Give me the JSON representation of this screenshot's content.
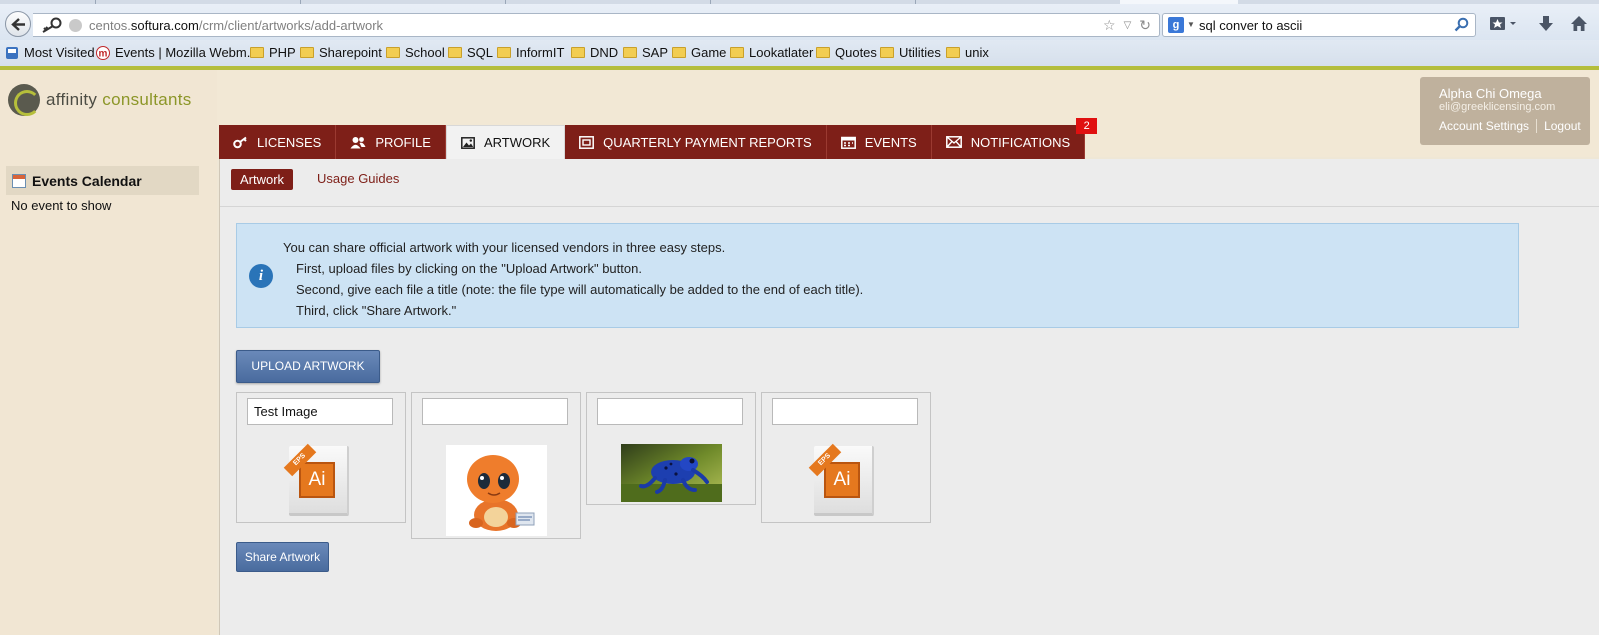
{
  "browser": {
    "url_prefix": "centos.",
    "url_domain": "softura.com",
    "url_path": "/crm/client/artworks/add-artwork",
    "search_query": "sql conver to ascii",
    "search_engine_letter": "g"
  },
  "bookmarks": [
    {
      "label": "Most Visited",
      "icon": "most-visited-icon"
    },
    {
      "label": "Events | Mozilla Webm...",
      "icon": "mozilla-icon"
    },
    {
      "label": "PHP",
      "icon": "folder-icon"
    },
    {
      "label": "Sharepoint",
      "icon": "folder-icon"
    },
    {
      "label": "School",
      "icon": "folder-icon"
    },
    {
      "label": "SQL",
      "icon": "folder-icon"
    },
    {
      "label": "InformIT",
      "icon": "folder-icon"
    },
    {
      "label": "DND",
      "icon": "folder-icon"
    },
    {
      "label": "SAP",
      "icon": "folder-icon"
    },
    {
      "label": "Game",
      "icon": "folder-icon"
    },
    {
      "label": "Lookatlater",
      "icon": "folder-icon"
    },
    {
      "label": "Quotes",
      "icon": "folder-icon"
    },
    {
      "label": "Utilities",
      "icon": "folder-icon"
    },
    {
      "label": "unix",
      "icon": "folder-icon"
    }
  ],
  "brand": {
    "name_first": "affinity",
    "name_second": "consultants",
    "color": "#7e1f18",
    "accent": "#b4be3c"
  },
  "sidebar": {
    "calendar_title": "Events Calendar",
    "empty_text": "No event to show"
  },
  "account": {
    "name": "Alpha Chi Omega",
    "email": "eli@greeklicensing.com",
    "settings_label": "Account Settings",
    "logout_label": "Logout"
  },
  "tabs": [
    {
      "label": "LICENSES",
      "icon": "key-icon",
      "active": false
    },
    {
      "label": "PROFILE",
      "icon": "users-icon",
      "active": false
    },
    {
      "label": "ARTWORK",
      "icon": "image-icon",
      "active": true
    },
    {
      "label": "QUARTERLY PAYMENT REPORTS",
      "icon": "report-icon",
      "active": false
    },
    {
      "label": "EVENTS",
      "icon": "calendar-icon",
      "active": false
    },
    {
      "label": "NOTIFICATIONS",
      "icon": "envelope-icon",
      "active": false,
      "badge": "2"
    }
  ],
  "subnav": {
    "active": "Artwork",
    "link": "Usage Guides"
  },
  "info": {
    "intro": "You can share official artwork with your licensed vendors in three easy steps.",
    "step1": "First, upload files by clicking on the \"Upload Artwork\" button.",
    "step2": "Second, give each file a title (note: the file type will automatically be added to the end of each title).",
    "step3": "Third, click \"Share Artwork.\""
  },
  "upload_label": "UPLOAD ARTWORK",
  "artworks": [
    {
      "title": "Test Image",
      "kind": "ai-file",
      "badge": "EPS",
      "type_label": "Ai"
    },
    {
      "title": "",
      "kind": "photo",
      "subject": "orange plush toy"
    },
    {
      "title": "",
      "kind": "photo",
      "subject": "blue poison dart frog"
    },
    {
      "title": "",
      "kind": "ai-file",
      "badge": "EPS",
      "type_label": "Ai"
    }
  ],
  "share_label": "Share Artwork"
}
